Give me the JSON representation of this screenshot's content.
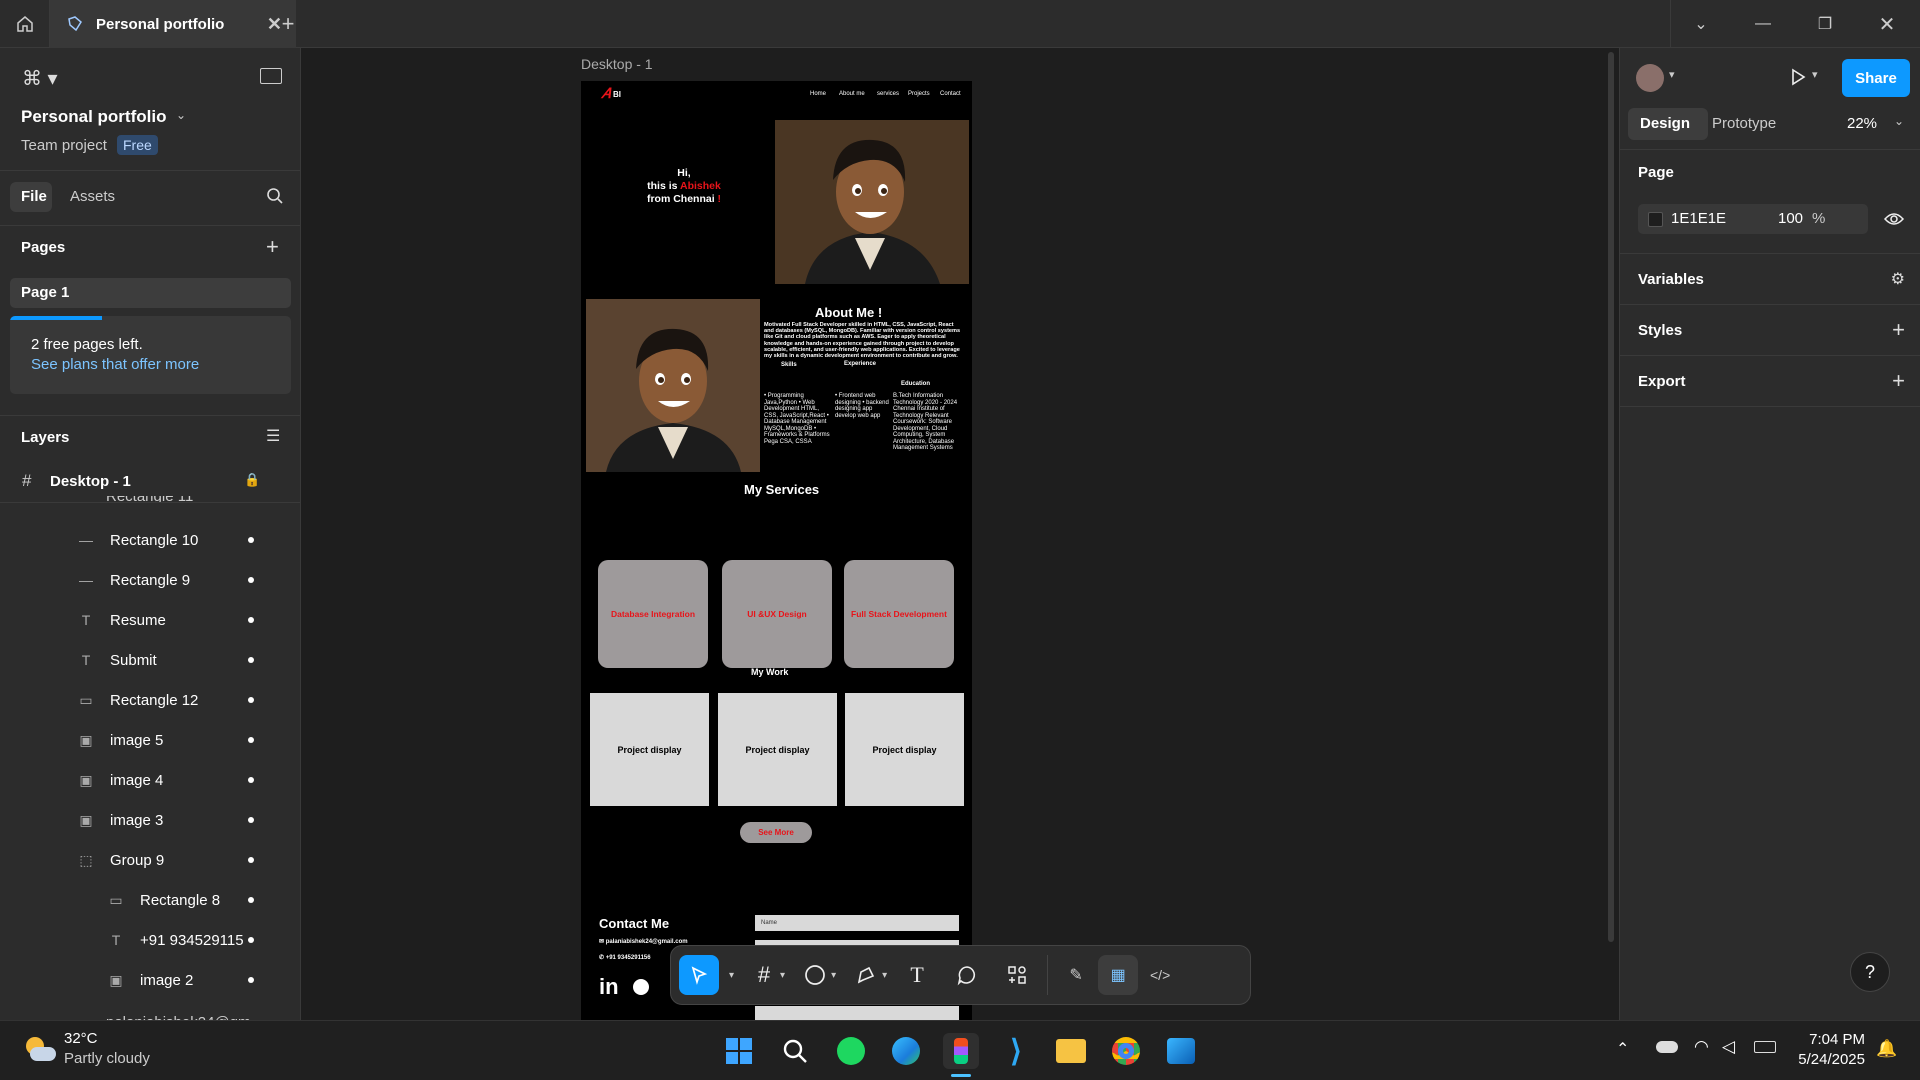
{
  "tab": {
    "title": "Personal portfolio"
  },
  "file": {
    "name": "Personal portfolio",
    "team": "Team project",
    "plan": "Free"
  },
  "panel_tabs": {
    "file": "File",
    "assets": "Assets"
  },
  "pages": {
    "header": "Pages",
    "current": "Page 1",
    "notice": "2 free pages left.",
    "link": "See plans that offer more",
    "progress": 0.33
  },
  "layers": {
    "header": "Layers",
    "frame": "Desktop - 1",
    "partial_top": "Rectangle 11",
    "items": [
      {
        "name": "Rectangle 10",
        "icon": "line",
        "indent": 1
      },
      {
        "name": "Rectangle 9",
        "icon": "line",
        "indent": 1
      },
      {
        "name": "Resume",
        "icon": "text",
        "indent": 1
      },
      {
        "name": "Submit",
        "icon": "text",
        "indent": 1
      },
      {
        "name": "Rectangle 12",
        "icon": "rect",
        "indent": 1
      },
      {
        "name": "image 5",
        "icon": "image",
        "indent": 1
      },
      {
        "name": "image 4",
        "icon": "image",
        "indent": 1
      },
      {
        "name": "image 3",
        "icon": "image",
        "indent": 1
      },
      {
        "name": "Group 9",
        "icon": "group",
        "indent": 1
      },
      {
        "name": "Rectangle 8",
        "icon": "rect",
        "indent": 2
      },
      {
        "name": "+91 934529115",
        "icon": "text",
        "indent": 2
      },
      {
        "name": "image 2",
        "icon": "image",
        "indent": 2
      }
    ],
    "partial_bottom": "palaniabishek24@gm"
  },
  "canvas": {
    "frame_label": "Desktop - 1"
  },
  "site": {
    "logo": "BI",
    "nav": [
      "Home",
      "About me",
      "services",
      "Projects",
      "Contact"
    ],
    "hero": {
      "hi": "Hi,",
      "this_is": "this is",
      "name": "Abishek",
      "from": "from Chennai",
      "bang": "!"
    },
    "about_title": "About Me !",
    "about_text": "Motivated Full Stack Developer skilled in HTML, CSS, JavaScript, React and databases (MySQL, MongoDB). Familiar with version control systems like Git and cloud platforms such as AWS. Eager to apply theoretical knowledge and hands-on experience gained through project to develop scalable, efficient, and user-friendly web applications. Excited to leverage my skills in a dynamic development environment to contribute and grow.",
    "skills_label": "Skills",
    "experience_label": "Experience",
    "education_label": "Education",
    "skills": "• Programming Java,Python • Web Development HTML, CSS, JavaScript,React • Database Management MySQL,MongoDB • Frameworks & Platforms Pega CSA, CSSA",
    "experience": "• Frontend web designing • backend designing app develop web app",
    "education": "B.Tech Information Technology 2020 - 2024 Chennai Institute of Technology Relevant Coursework: Software Development, Cloud Computing, System Architecture, Database Management Systems",
    "services_title": "My Services",
    "services": [
      "Database Integration",
      "UI &UX Design",
      "Full Stack Development"
    ],
    "work_title": "My Work",
    "projects": [
      "Project display",
      "Project display",
      "Project display"
    ],
    "see_more": "See More",
    "contact_title": "Contact Me",
    "email": "palaniabishek24@gmail.com",
    "phone": "+91 9345291156",
    "name_placeholder": "Name"
  },
  "right": {
    "design_tab": "Design",
    "prototype_tab": "Prototype",
    "zoom": "22%",
    "share": "Share",
    "page_header": "Page",
    "color": "1E1E1E",
    "opacity": "100",
    "percent": "%",
    "variables": "Variables",
    "styles": "Styles",
    "export": "Export",
    "help": "?"
  },
  "taskbar": {
    "temp": "32°C",
    "weather": "Partly cloudy",
    "time": "7:04 PM",
    "date": "5/24/2025"
  },
  "colors": {
    "accent": "#0d99ff",
    "site_red": "#e8141a",
    "bg": "#1e1e1e",
    "panel": "#2c2c2c"
  }
}
